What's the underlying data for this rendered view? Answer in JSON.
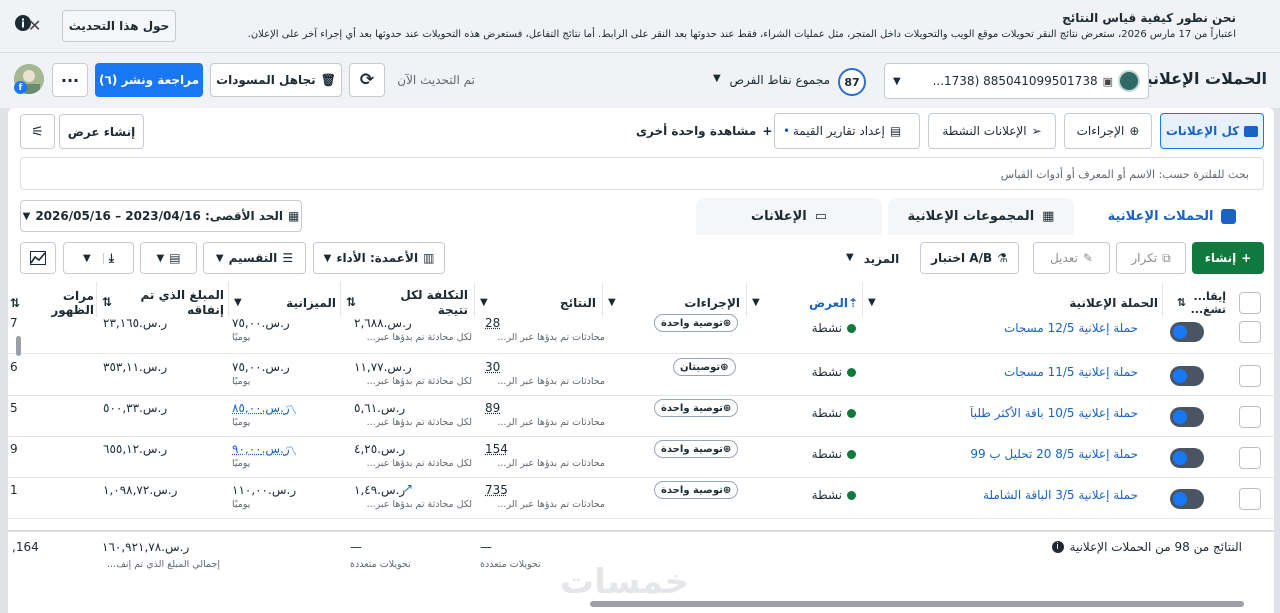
{
  "banner": {
    "title": "نحن نطور كيفية قياس النتائج",
    "text": "اعتباراً من 17 مارس 2026، ستعرض نتائج النقر تحويلات موقع الويب والتحويلات داخل المتجر، مثل عمليات الشراء، فقط عند حدوثها بعد النقر على الرابط. أما نتائج التفاعل، فستعرض هذه التحويلات عند حدوثها بعد أي إجراء آخر على الإعلان.",
    "about_button": "حول هذا التحديث",
    "close_icon": "close-icon"
  },
  "header": {
    "page_title": "الحملات الإعلانية",
    "account_label": "885041099501738 (1738...",
    "opportunity_label": "مجموع نقاط الفرص",
    "opportunity_score": "87",
    "refresh_text": "تم التحديث الآن",
    "discard_label": "تجاهل المسودات",
    "review_label": "مراجعة ونشر (٦)"
  },
  "toolbar": {
    "all_ads": "كل الإعلانات",
    "actions": "الإجراءات",
    "active_ads": "الإعلانات النشطة",
    "value_reports": "إعداد تقارير القيمة",
    "more_views": "مشاهدة واحدة أخرى",
    "create_view": "إنشاء عرض"
  },
  "search": {
    "placeholder": "بحث للفلترة حسب: الاسم أو المعرف أو أدوات القياس"
  },
  "tabs": {
    "campaigns": "الحملات الإعلانية",
    "adsets": "المجموعات الإعلانية",
    "ads": "الإعلانات"
  },
  "date_range": "الحد الأقصى: 2023/04/16 – 2026/05/16",
  "actionbar": {
    "create": "إنشاء",
    "duplicate": "تكرار",
    "edit": "تعديل",
    "ab_test": "اختبار A/B",
    "more": "المزيد",
    "columns": "الأعمدة: الأداء",
    "breakdown": "التقسيم"
  },
  "columns": {
    "off_on": "إيقا... تشغ...",
    "campaign": "الحملة الإعلانية",
    "delivery": "العرض",
    "actions": "الإجراءات",
    "results": "النتائج",
    "cost_per_result": "التكلفة لكل نتيجة",
    "budget": "الميزانية",
    "amount_spent": "المبلغ الذي تم إنفاقه",
    "impressions": "مرات الظهور"
  },
  "rows": [
    {
      "name": "حملة إعلانية 12/5 مسجات",
      "status": "نشطة",
      "rec": "توصية واحدة",
      "results": "28",
      "results_sub": "محادثات تم بدؤها عبر الر...",
      "cpr": "ر.س.٢,٦٨٨",
      "cpr_sub": "لكل محادثة تم بدؤها عبر...",
      "budget": "ر.س.٧٥,٠٠",
      "budget_sub": "يوميًا",
      "spent": "ر.س.٢٣,١٦٥",
      "impr": "7"
    },
    {
      "name": "حملة إعلانية 11/5 مسجات",
      "status": "نشطة",
      "rec": "توصيتان",
      "results": "30",
      "results_sub": "محادثات تم بدؤها عبر الر...",
      "cpr": "ر.س.١١,٧٧",
      "cpr_sub": "لكل محادثة تم بدؤها عبر...",
      "budget": "ر.س.٧٥,٠٠",
      "budget_sub": "يوميًا",
      "spent": "ر.س.٣٥٣,١١",
      "impr": "6"
    },
    {
      "name": "حملة إعلانية 10/5 باقة الأكثر طلباً",
      "status": "نشطة",
      "rec": "توصية واحدة",
      "results": "89",
      "results_sub": "محادثات تم بدؤها عبر الر...",
      "cpr": "ر.س.٥,٦١",
      "cpr_sub": "لكل محادثة تم بدؤها عبر...",
      "budget": "ر.س.٨٥,٠٠",
      "budget_sub": "يوميًا",
      "spent": "ر.س.٥٠٠,٣٣",
      "impr": "5"
    },
    {
      "name": "حملة إعلانية 8/5 20 تحليل ب 99",
      "status": "نشطة",
      "rec": "توصية واحدة",
      "results": "154",
      "results_sub": "محادثات تم بدؤها عبر الر...",
      "cpr": "ر.س.٤,٢٥",
      "cpr_sub": "لكل محادثة تم بدؤها عبر...",
      "budget": "ر.س.٩٠,٠٠",
      "budget_sub": "يوميًا",
      "spent": "ر.س.٦٥٥,١٢",
      "impr": "9"
    },
    {
      "name": "حملة إعلانية 3/5 الباقة الشاملة",
      "status": "نشطة",
      "rec": "توصية واحدة",
      "results": "735",
      "results_sub": "محادثات تم بدؤها عبر الر...",
      "cpr": "ر.س.١,٤٩",
      "cpr_sub": "لكل محادثة تم بدؤها عبر...",
      "budget": "ر.س.١١٠,٠٠",
      "budget_sub": "يوميًا",
      "spent": "ر.س.١,٠٩٨,٧٢",
      "impr": "1"
    }
  ],
  "footer": {
    "label": "النتائج من 98 من الحملات الإعلانية",
    "results": "—",
    "results_sub": "تحويلات متعددة",
    "cpr": "—",
    "cpr_sub": "تحويلات متعددة",
    "spent": "ر.س.١٦٠,٩٢١,٧٨",
    "spent_sub": "إجمالي المبلغ الذي تم إنف...",
    "impr": "164,"
  },
  "watermark": "خمسات"
}
